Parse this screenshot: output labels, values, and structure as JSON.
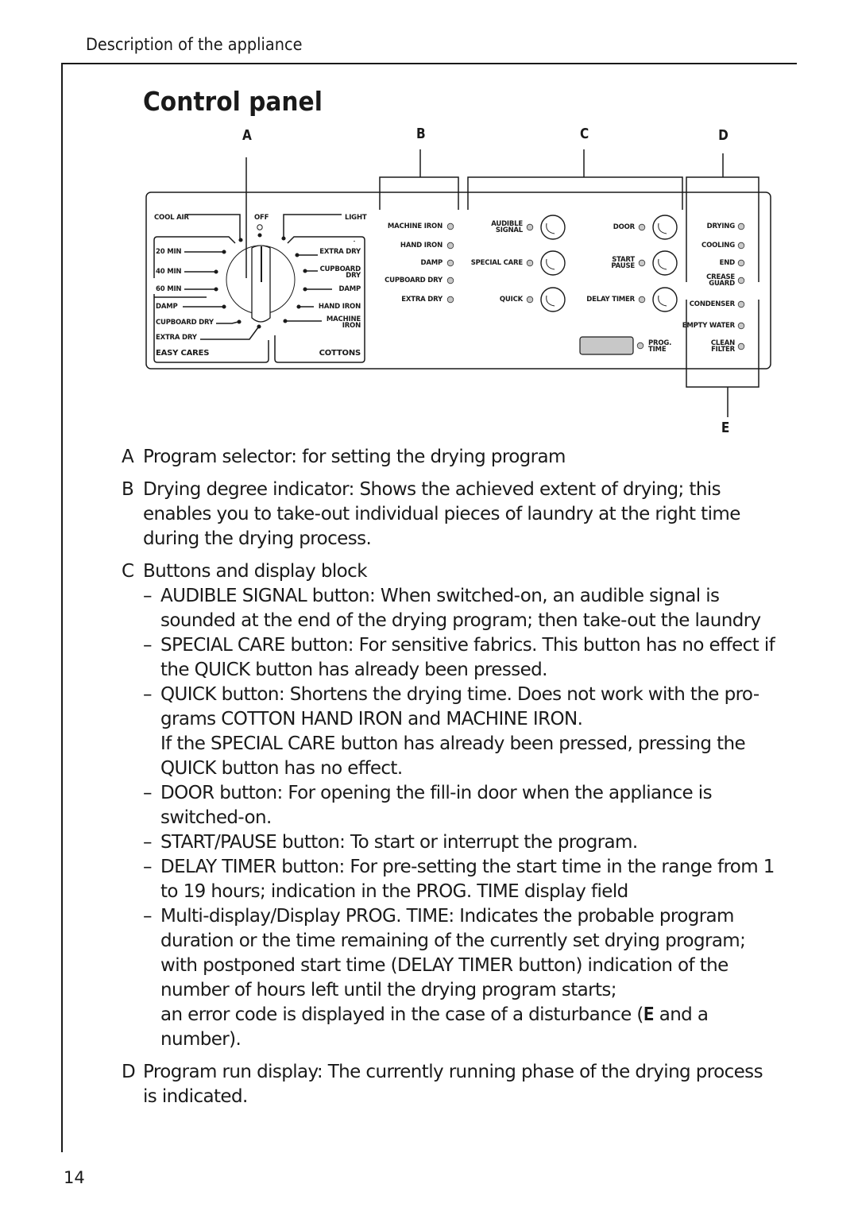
{
  "header": {
    "section": "Description of the appliance"
  },
  "title": "Control panel",
  "page_number": "14",
  "callouts": {
    "a": "A",
    "b": "B",
    "c": "C",
    "d": "D",
    "e": "E"
  },
  "panel": {
    "selector": {
      "top": {
        "cool_air": "COOL AIR",
        "off": "OFF",
        "light": "LIGHT"
      },
      "easy_cares_group": "EASY CARES",
      "easy_cares": [
        "20 MIN",
        "40 MIN",
        "60 MIN",
        "DAMP",
        "CUPBOARD DRY",
        "EXTRA DRY"
      ],
      "cottons_group": "COTTONS",
      "cottons": [
        "EXTRA DRY",
        "CUPBOARD DRY",
        "DAMP",
        "HAND IRON",
        "MACHINE IRON"
      ]
    },
    "drying_degree": [
      "MACHINE IRON",
      "HAND IRON",
      "DAMP",
      "CUPBOARD DRY",
      "EXTRA DRY"
    ],
    "buttons_left": [
      "AUDIBLE SIGNAL",
      "SPECIAL CARE",
      "QUICK"
    ],
    "buttons_right": [
      "DOOR",
      "START PAUSE",
      "DELAY TIMER"
    ],
    "display_label": "PROG. TIME",
    "run_display": [
      "DRYING",
      "COOLING",
      "END",
      "CREASE GUARD"
    ],
    "warnings": [
      "CONDENSER",
      "EMPTY WATER",
      "CLEAN FILTER"
    ],
    "colors": {
      "led": "#c8c8c8",
      "display": "#c8c8c8",
      "line": "#1a1a1a"
    }
  },
  "descriptions": {
    "a": {
      "key": "A",
      "text": "Program selector: for setting the drying program"
    },
    "b": {
      "key": "B",
      "text": "Drying degree indicator: Shows the achieved extent of drying; this enables you to take-out individual pieces of laundry at the right time during the drying process."
    },
    "c": {
      "key": "C",
      "text": "Buttons and display block",
      "dash": "–",
      "items": [
        "AUDIBLE SIGNAL button: When switched-on, an audible signal is sounded at the end of the drying program; then take-out the laundry",
        "SPECIAL CARE button: For sensitive fabrics. This button has no effect if the QUICK button has already been pressed.",
        "QUICK button: Shortens the drying time. Does not work with the pro- grams COTTON HAND IRON and MACHINE IRON.",
        "DOOR button: For opening the fill-in door when the appliance is switched-on.",
        "START/PAUSE button: To start or interrupt the program.",
        "DELAY TIMER button: For pre-setting the start time in the range from 1 to 19 hours; indication in the PROG. TIME display field",
        "Multi-display/Display PROG. TIME: Indicates the probable program duration or the time remaining of the currently set drying program; with postponed start time (DELAY TIMER button) indication of the number of hours left until the drying program starts;"
      ],
      "quick_note": "If the SPECIAL CARE button has already been pressed, pressing the QUICK button has no effect.",
      "error_note_before": "an error code is displayed in the case of a disturbance (",
      "error_glyph": "E",
      "error_note_after": " and a number)."
    },
    "d": {
      "key": "D",
      "text": "Program run display: The currently running phase of the drying process is indicated."
    }
  }
}
